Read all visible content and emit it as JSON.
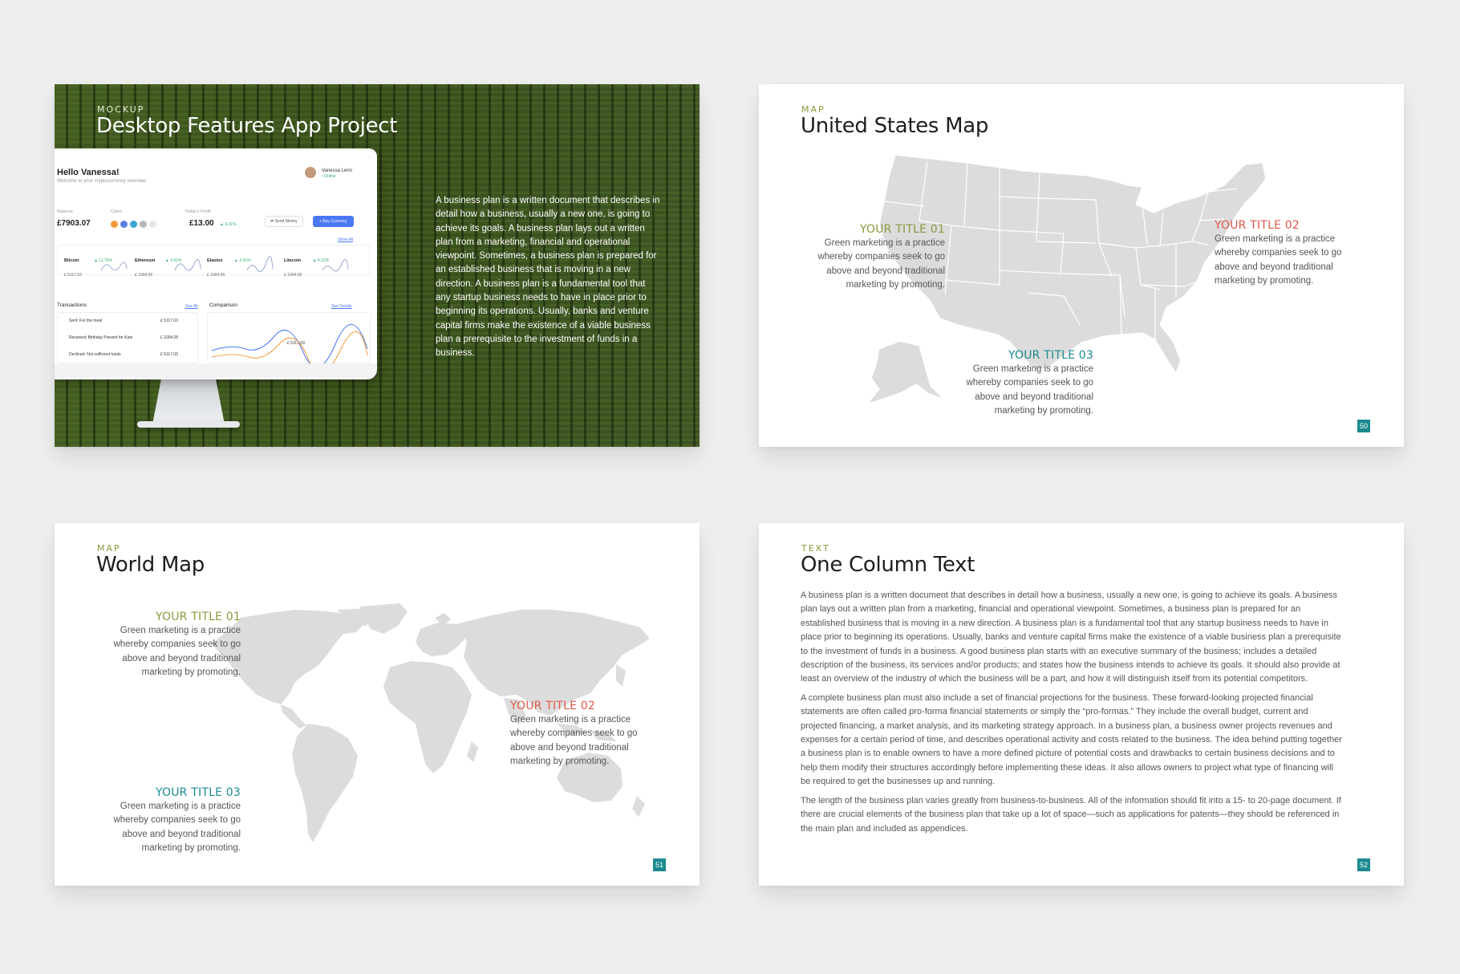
{
  "slide1": {
    "eyebrow": "MOCKUP",
    "title": "Desktop Features App Project",
    "body": "A business plan is a written document that describes in detail how a business, usually a new one, is going to achieve its goals. A business plan lays out a written plan from a marketing, financial and operational viewpoint. Sometimes, a business plan is prepared for an established business that is moving in a new direction. A business plan is a fundamental tool that any startup business needs to have in place prior to beginning its operations. Usually, banks and venture capital firms make the existence of a viable business plan a prerequisite to the investment of funds in a business.",
    "screen": {
      "greeting": "Hello Vanessa!",
      "subtitle": "Welcome to your cryptocurrency overview",
      "user_name": "Vanessa Lenn",
      "user_status": "• Online",
      "balance_label": "Balance",
      "balance_value": "£7903.07",
      "coins_label": "Coins",
      "profit_label": "Today's Profit",
      "profit_value": "£13.00",
      "profit_pct": "▲ 4.31%",
      "send_button": "⇄ Send Money",
      "buy_button": "+ Buy Currency",
      "show_all": "Show All",
      "tickers": [
        {
          "name": "Bitcoin",
          "pct": "▲ 11.75%",
          "value": "£ 5117.03"
        },
        {
          "name": "Ethereum",
          "pct": "▲ 4.91%",
          "value": "£ 1004.05"
        },
        {
          "name": "Elastos",
          "pct": "▲ 4.31%",
          "value": "£ 1004.05"
        },
        {
          "name": "Litecoin",
          "pct": "▲ 4.31%",
          "value": "£ 1004.05"
        }
      ],
      "transactions_label": "Transactions",
      "see_all": "See All",
      "transactions": [
        {
          "label": "Sent: For the meal",
          "amount": "£ 5117.03"
        },
        {
          "label": "Received: Birthday Present for Kate",
          "amount": "£ 1004.05"
        },
        {
          "label": "Declined: Not sufficient funds",
          "amount": "£ 5117.03"
        }
      ],
      "comparison_label": "Comparison",
      "see_details": "See Details",
      "comparison_value": "£ 5117.03"
    }
  },
  "slide2": {
    "eyebrow": "MAP",
    "title": "United States Map",
    "page": "50",
    "title01": "YOUR TITLE 01",
    "title02": "YOUR TITLE 02",
    "title03": "YOUR TITLE 03",
    "desc": "Green marketing is a practice whereby companies seek to go above and beyond traditional marketing by promoting."
  },
  "slide3": {
    "eyebrow": "MAP",
    "title": "World Map",
    "page": "51",
    "title01": "YOUR TITLE 01",
    "title02": "YOUR TITLE 02",
    "title03": "YOUR TITLE 03",
    "desc": "Green marketing is a practice whereby companies seek to go above and beyond traditional marketing by promoting."
  },
  "slide4": {
    "eyebrow": "TEXT",
    "title": "One Column Text",
    "page": "52",
    "paragraphs": [
      "A business plan is a written document that describes in detail how a business, usually a new one, is going to achieve its goals. A business plan lays out a written plan from a marketing, financial and operational viewpoint. Sometimes, a business plan is prepared for an established business that is moving in a new direction. A business plan is a fundamental tool that any startup business needs to have in place prior to beginning its operations. Usually, banks and venture capital firms make the existence of a viable business plan a prerequisite to the investment of funds in a business. A good business plan starts with an executive summary of the business; includes a detailed description of the business, its services and/or products; and states how the business intends to achieve its goals. It should also provide at least an overview of the industry of which the business will be a part, and how it will distinguish itself from its potential competitors.",
      "A complete business plan must also include a set of financial projections for the business. These forward-looking projected financial statements are often called pro-forma financial statements or simply the “pro-formas.” They include the overall budget, current and projected financing, a market analysis, and its marketing strategy approach. In a business plan, a business owner projects revenues and expenses for a certain period of time, and describes operational activity and costs related to the business. The idea behind putting together a business plan is to enable owners to have a more defined picture of potential costs and drawbacks to certain business decisions and to help them modify their structures accordingly before implementing these ideas. It also allows owners to project what type of financing will be required to get the businesses up and running.",
      "The length of the business plan varies greatly from business-to-business. All of the information should fit into a 15- to 20-page document. If there are crucial elements of the business plan that take up a lot of space—such as applications for patents—they should be referenced in the main plan and included as appendices."
    ]
  },
  "colors": {
    "accent_green": "#8a9a3c",
    "accent_red": "#e0584a",
    "accent_teal": "#1b8a8f",
    "map_gray": "#dcdcdc"
  }
}
